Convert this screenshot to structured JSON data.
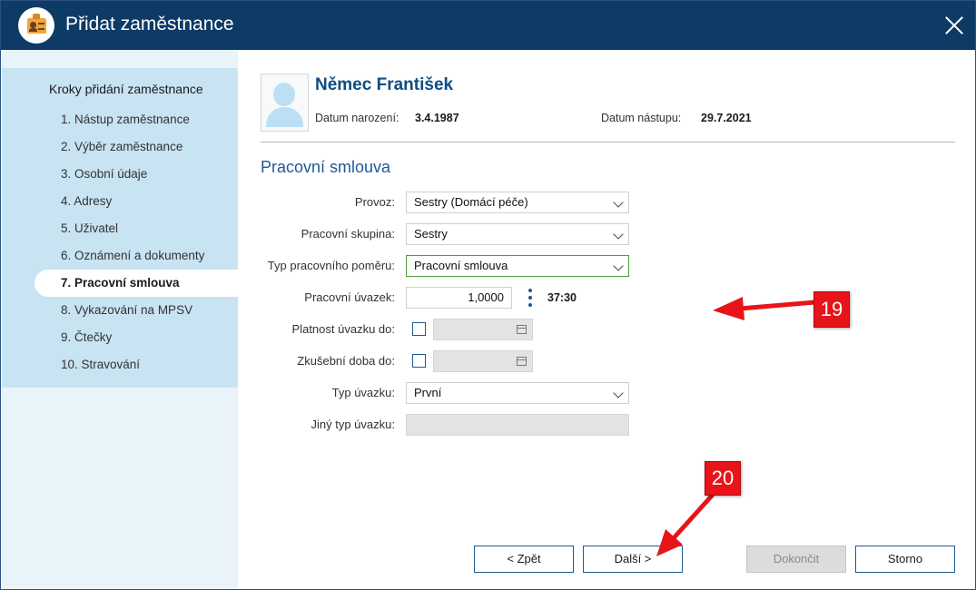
{
  "window": {
    "title": "Přidat zaměstnance"
  },
  "sidebar": {
    "heading": "Kroky přidání zaměstnance",
    "steps": [
      {
        "label": "1. Nástup zaměstnance"
      },
      {
        "label": "2. Výběr zaměstnance"
      },
      {
        "label": "3. Osobní údaje"
      },
      {
        "label": "4. Adresy"
      },
      {
        "label": "5. Uživatel"
      },
      {
        "label": "6. Oznámení a dokumenty"
      },
      {
        "label": "7. Pracovní smlouva"
      },
      {
        "label": "8. Vykazování na MPSV"
      },
      {
        "label": "9. Čtečky"
      },
      {
        "label": "10. Stravování"
      }
    ],
    "active_index": 6
  },
  "employee": {
    "name": "Němec František",
    "birth_label": "Datum narození:",
    "birth_value": "3.4.1987",
    "start_label": "Datum nástupu:",
    "start_value": "29.7.2021"
  },
  "section": {
    "title": "Pracovní smlouva"
  },
  "form": {
    "provoz": {
      "label": "Provoz:",
      "value": "Sestry (Domácí péče)"
    },
    "skupina": {
      "label": "Pracovní skupina:",
      "value": "Sestry"
    },
    "typ_pomeru": {
      "label": "Typ pracovního poměru:",
      "value": "Pracovní smlouva"
    },
    "uvazek": {
      "label": "Pracovní úvazek:",
      "value": "1,0000",
      "hours": "37:30"
    },
    "platnost": {
      "label": "Platnost úvazku do:"
    },
    "zkusebni": {
      "label": "Zkušební doba do:"
    },
    "typ_uvazku": {
      "label": "Typ úvazku:",
      "value": "První"
    },
    "jiny_typ": {
      "label": "Jiný typ úvazku:"
    }
  },
  "buttons": {
    "back": "< Zpět",
    "next": "Další >",
    "finish": "Dokončit",
    "cancel": "Storno"
  },
  "annotations": {
    "badge_19": "19",
    "badge_20": "20"
  },
  "colors": {
    "titlebar": "#0e3a66",
    "sidebar": "#c8e3f2",
    "accent": "#1f5a95",
    "annotation": "#e8141a"
  }
}
